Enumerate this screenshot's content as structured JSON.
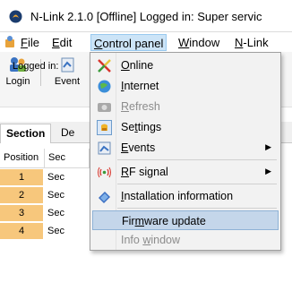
{
  "window": {
    "title": "N-Link 2.1.0 [Offline] Logged in: Super servic"
  },
  "menubar": {
    "file": {
      "underline": "F",
      "rest": "ile"
    },
    "edit": {
      "underline": "E",
      "rest": "dit"
    },
    "control_panel": {
      "underline": "C",
      "rest": "ontrol panel"
    },
    "window": {
      "underline": "W",
      "rest": "indow"
    },
    "nlink": {
      "underline": "N",
      "rest": "-Link"
    }
  },
  "toolbar": {
    "login_label": "Login",
    "events_label": "Event",
    "logged_in_label": "Logged in:"
  },
  "tabs": [
    "Section",
    "De"
  ],
  "table": {
    "headers": [
      "Position",
      "Sec"
    ],
    "rows": [
      {
        "position": "1",
        "section": "Sec"
      },
      {
        "position": "2",
        "section": "Sec"
      },
      {
        "position": "3",
        "section": "Sec"
      },
      {
        "position": "4",
        "section": "Sec"
      }
    ]
  },
  "control_panel_menu": {
    "items": [
      {
        "pre": "",
        "ul": "O",
        "post": "nline",
        "icon": "online-icon",
        "disabled": false
      },
      {
        "pre": "",
        "ul": "I",
        "post": "nternet",
        "icon": "internet-icon",
        "disabled": false
      },
      {
        "pre": "",
        "ul": "R",
        "post": "efresh",
        "icon": "refresh-icon",
        "disabled": true
      },
      {
        "pre": "Se",
        "ul": "t",
        "post": "tings",
        "icon": "settings-icon",
        "disabled": false
      },
      {
        "pre": "",
        "ul": "E",
        "post": "vents",
        "icon": "events-icon",
        "disabled": false
      },
      {
        "pre": "",
        "ul": "R",
        "post": "F signal",
        "icon": "rf-signal-icon",
        "disabled": false
      },
      {
        "pre": "",
        "ul": "I",
        "post": "nstallation information",
        "icon": "installation-info-icon",
        "disabled": false
      },
      {
        "pre": "Fir",
        "ul": "m",
        "post": "ware update",
        "icon": "",
        "disabled": false
      },
      {
        "pre": "Info ",
        "ul": "w",
        "post": "indow",
        "icon": "",
        "disabled": true
      }
    ]
  },
  "colors": {
    "position_cell": "#f7c77c",
    "highlight": "#c4d6ea",
    "menu_active": "#cce4f7"
  }
}
